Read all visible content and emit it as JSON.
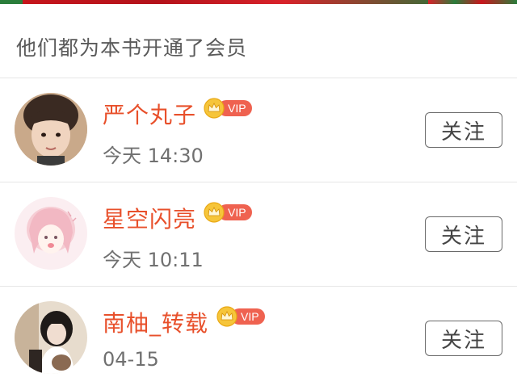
{
  "header": {
    "title": "他们都为本书开通了会员"
  },
  "members": [
    {
      "name": "严个丸子",
      "time": "今天 14:30",
      "vip": "VIP",
      "follow": "关注"
    },
    {
      "name": "星空闪亮",
      "time": "今天 10:11",
      "vip": "VIP",
      "follow": "关注"
    },
    {
      "name": "南柚_转载",
      "time": "04-15",
      "vip": "VIP",
      "follow": "关注"
    }
  ],
  "colors": {
    "name": "#e8502b",
    "vip_badge": "#ef6250",
    "crown": "#f3b71e"
  }
}
